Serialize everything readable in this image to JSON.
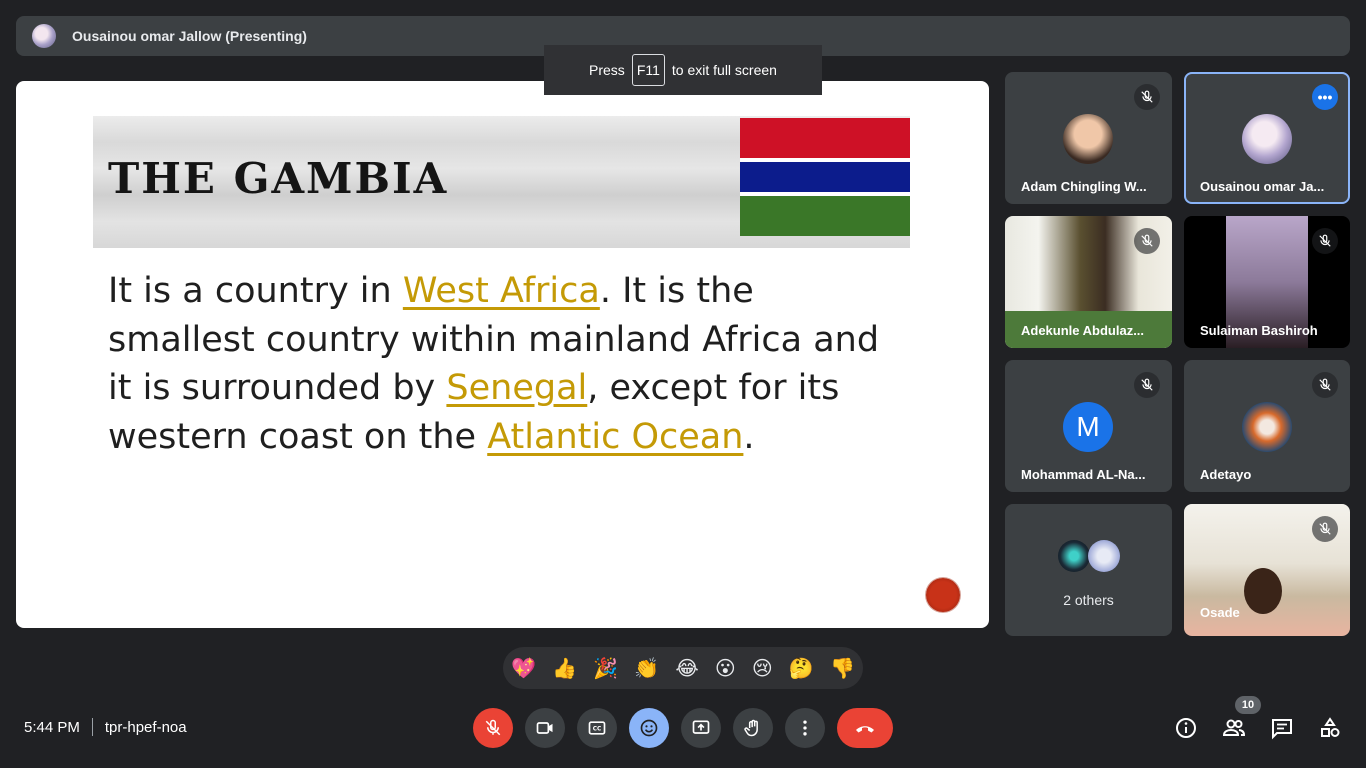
{
  "presenter": {
    "name": "Ousainou omar Jallow (Presenting)"
  },
  "toast": {
    "before": "Press",
    "key": "F11",
    "after": "to exit full screen"
  },
  "slide": {
    "title": "THE GAMBIA",
    "text_1": "It is a country in ",
    "link_1": "West Africa",
    "text_2": ". It is the smallest country within mainland Africa  and it is surrounded by ",
    "link_2": "Senegal",
    "text_3": ", except for its western coast on the ",
    "link_3": "Atlantic Ocean",
    "text_4": "."
  },
  "participants": [
    {
      "name": "Adam Chingling W...",
      "muted": true
    },
    {
      "name": "Ousainou omar Ja...",
      "muted": false,
      "active": true
    },
    {
      "name": "Adekunle Abdulaz...",
      "muted": true
    },
    {
      "name": "Sulaiman Bashiroh",
      "muted": true
    },
    {
      "name": "Mohammad AL-Na...",
      "muted": true,
      "initial": "M"
    },
    {
      "name": "Adetayo",
      "muted": true
    },
    {
      "name": "2 others"
    },
    {
      "name": "Osade",
      "muted": true
    }
  ],
  "reactions": [
    "💖",
    "👍",
    "🎉",
    "👏",
    "😂",
    "😮",
    "😢",
    "🤔",
    "👎"
  ],
  "meeting": {
    "time": "5:44 PM",
    "code": "tpr-hpef-noa",
    "participant_count": "10"
  },
  "colors": {
    "accent": "#8ab4f8",
    "danger": "#ea4335",
    "link": "#c49a06",
    "tile": "#3c4043"
  }
}
